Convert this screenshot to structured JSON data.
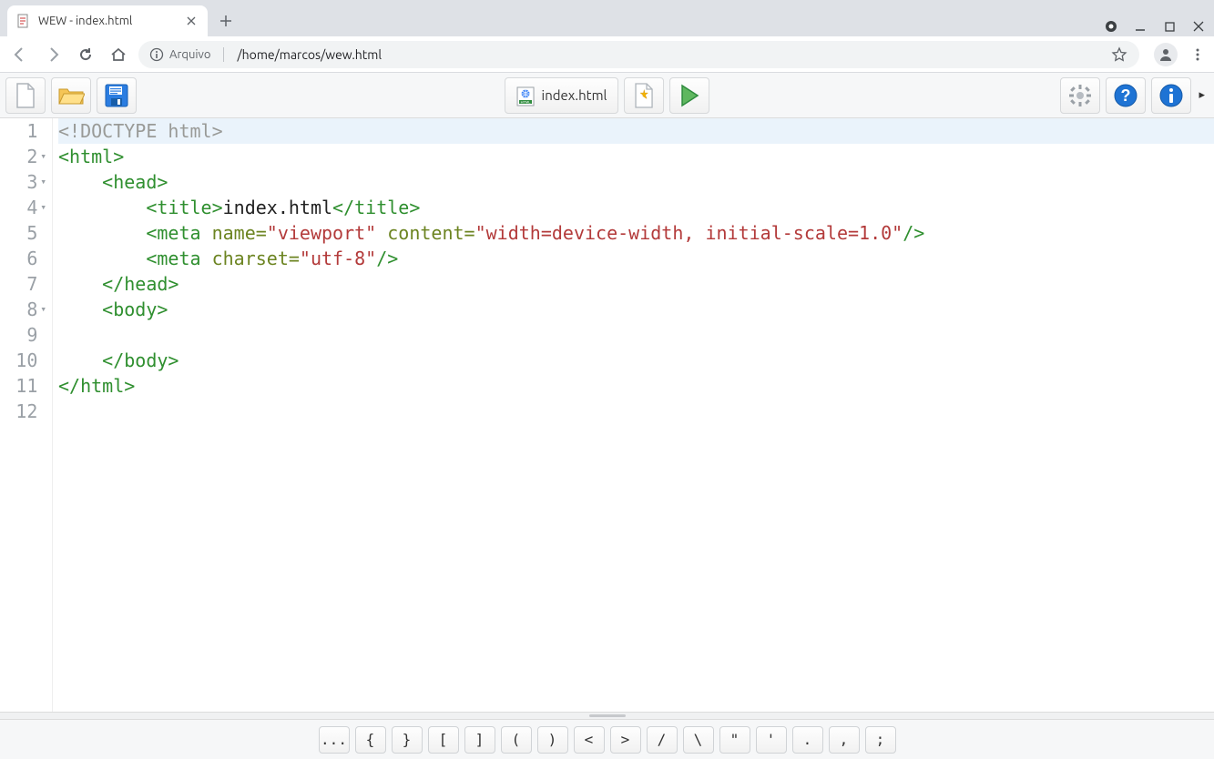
{
  "window": {
    "tab_title": "WEW - index.html",
    "minimize": "—",
    "maximize": "▢",
    "close": "✕"
  },
  "address": {
    "scheme_label": "Arquivo",
    "path": "/home/marcos/wew.html"
  },
  "toolbar": {
    "open_file_label": "index.html"
  },
  "editor": {
    "lines": [
      {
        "num": "1",
        "fold": "",
        "tokens": [
          {
            "cls": "t-doctype",
            "t": "<!DOCTYPE html>"
          }
        ]
      },
      {
        "num": "2",
        "fold": "▾",
        "tokens": [
          {
            "cls": "t-tag",
            "t": "<html>"
          }
        ]
      },
      {
        "num": "3",
        "fold": "▾",
        "tokens": [
          {
            "cls": "",
            "t": "    "
          },
          {
            "cls": "t-tag",
            "t": "<head>"
          }
        ]
      },
      {
        "num": "4",
        "fold": "▾",
        "tokens": [
          {
            "cls": "",
            "t": "        "
          },
          {
            "cls": "t-tag",
            "t": "<title>"
          },
          {
            "cls": "t-text",
            "t": "index.html"
          },
          {
            "cls": "t-tag",
            "t": "</title>"
          }
        ]
      },
      {
        "num": "5",
        "fold": "",
        "tokens": [
          {
            "cls": "",
            "t": "        "
          },
          {
            "cls": "t-tag",
            "t": "<meta "
          },
          {
            "cls": "t-attr",
            "t": "name="
          },
          {
            "cls": "t-str",
            "t": "\"viewport\""
          },
          {
            "cls": "t-tag",
            "t": " "
          },
          {
            "cls": "t-attr",
            "t": "content="
          },
          {
            "cls": "t-str",
            "t": "\"width=device-width, initial-scale=1.0\""
          },
          {
            "cls": "t-tag",
            "t": "/>"
          }
        ]
      },
      {
        "num": "6",
        "fold": "",
        "tokens": [
          {
            "cls": "",
            "t": "        "
          },
          {
            "cls": "t-tag",
            "t": "<meta "
          },
          {
            "cls": "t-attr",
            "t": "charset="
          },
          {
            "cls": "t-str",
            "t": "\"utf-8\""
          },
          {
            "cls": "t-tag",
            "t": "/>"
          }
        ]
      },
      {
        "num": "7",
        "fold": "",
        "tokens": [
          {
            "cls": "",
            "t": "    "
          },
          {
            "cls": "t-tag",
            "t": "</head>"
          }
        ]
      },
      {
        "num": "8",
        "fold": "▾",
        "tokens": [
          {
            "cls": "",
            "t": "    "
          },
          {
            "cls": "t-tag",
            "t": "<body>"
          }
        ]
      },
      {
        "num": "9",
        "fold": "",
        "tokens": [
          {
            "cls": "",
            "t": ""
          }
        ]
      },
      {
        "num": "10",
        "fold": "",
        "tokens": [
          {
            "cls": "",
            "t": "    "
          },
          {
            "cls": "t-tag",
            "t": "</body>"
          }
        ]
      },
      {
        "num": "11",
        "fold": "",
        "tokens": [
          {
            "cls": "t-tag",
            "t": "</html>"
          }
        ]
      },
      {
        "num": "12",
        "fold": "",
        "tokens": [
          {
            "cls": "",
            "t": ""
          }
        ]
      }
    ]
  },
  "symbols": [
    "...",
    "{",
    "}",
    "[",
    "]",
    "(",
    ")",
    "<",
    ">",
    "/",
    "\\",
    "\"",
    "'",
    ".",
    ",",
    ";"
  ]
}
